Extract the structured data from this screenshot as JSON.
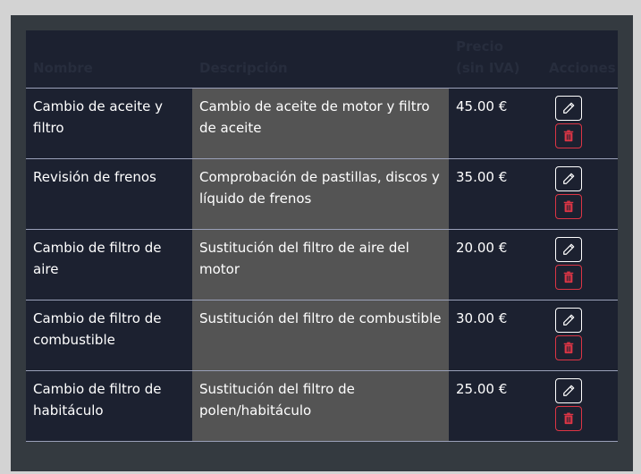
{
  "table": {
    "headers": {
      "name": "Nombre",
      "description": "Descripción",
      "price": "Precio (sin IVA)",
      "actions": "Acciones"
    },
    "rows": [
      {
        "name": "Cambio de aceite y filtro",
        "description": "Cambio de aceite de motor y filtro de aceite",
        "price": "45.00 €"
      },
      {
        "name": "Revisión de frenos",
        "description": "Comprobación de pastillas, discos y líquido de frenos",
        "price": "35.00 €"
      },
      {
        "name": "Cambio de filtro de aire",
        "description": "Sustitución del filtro de aire del motor",
        "price": "20.00 €"
      },
      {
        "name": "Cambio de filtro de combustible",
        "description": "Sustitución del filtro de combustible",
        "price": "30.00 €"
      },
      {
        "name": "Cambio de filtro de habitáculo",
        "description": "Sustitución del filtro de polen/habitáculo",
        "price": "25.00 €"
      }
    ],
    "icons": {
      "edit": "pencil-icon",
      "delete": "trash-icon"
    }
  },
  "colors": {
    "accent_danger": "#dc3545",
    "table_bg": "#1c2130",
    "desc_bg": "#545454"
  }
}
